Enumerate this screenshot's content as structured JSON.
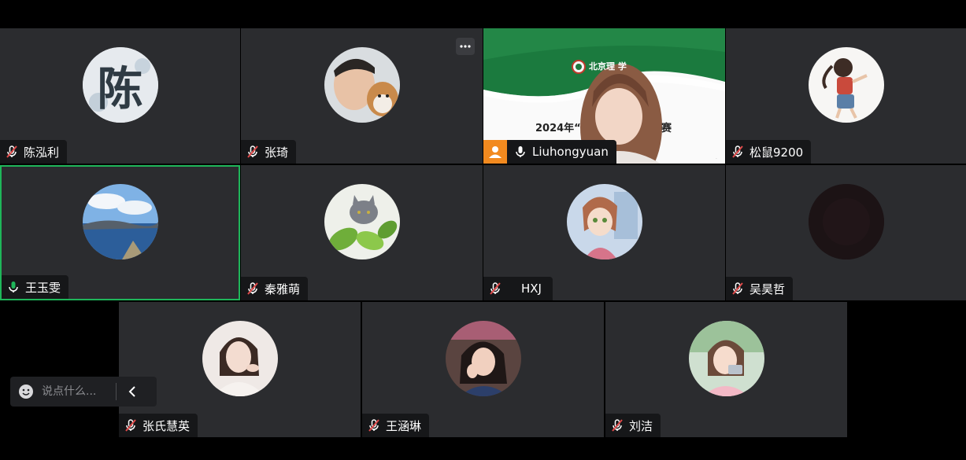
{
  "participants": [
    {
      "name": "陈泓利"
    },
    {
      "name": "张琦"
    },
    {
      "name": "Liuhongyuan",
      "slide_title_left": "2024年“",
      "slide_title_right": "赛",
      "slide_logo_text": "北京理 学"
    },
    {
      "name": "松鼠9200"
    },
    {
      "name": "王玉雯"
    },
    {
      "name": "秦雅萌"
    },
    {
      "name": "HXJ"
    },
    {
      "name": "吴昊哲"
    },
    {
      "name": "张氏慧英"
    },
    {
      "name": "王涵琳"
    },
    {
      "name": "刘洁"
    }
  ],
  "avatar_glyph": "陈",
  "chat": {
    "placeholder": "说点什么..."
  },
  "colors": {
    "active_speaker_border": "#1fb65a",
    "muted_icon": "#e04a4a",
    "presenter_badge": "#f28a1f"
  }
}
